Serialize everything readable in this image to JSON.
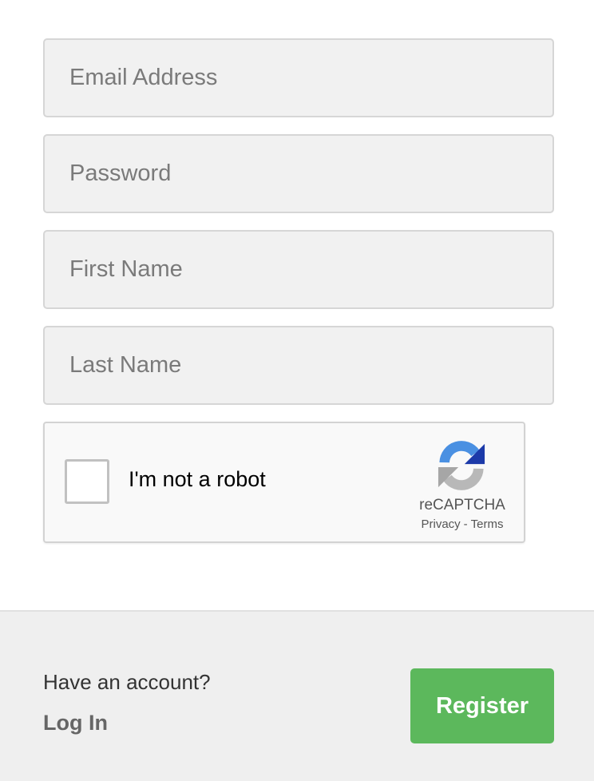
{
  "form": {
    "email": {
      "placeholder": "Email Address",
      "value": ""
    },
    "password": {
      "placeholder": "Password",
      "value": ""
    },
    "first_name": {
      "placeholder": "First Name",
      "value": ""
    },
    "last_name": {
      "placeholder": "Last Name",
      "value": ""
    }
  },
  "captcha": {
    "label": "I'm not a robot",
    "brand": "reCAPTCHA",
    "privacy": "Privacy",
    "separator": "-",
    "terms": "Terms",
    "checked": false,
    "icon": "recaptcha-logo-icon"
  },
  "footer": {
    "prompt": "Have an account?",
    "login_label": "Log In",
    "register_label": "Register"
  },
  "colors": {
    "register_bg": "#5cb85c",
    "field_bg": "#f1f1f1",
    "footer_bg": "#efefef"
  }
}
